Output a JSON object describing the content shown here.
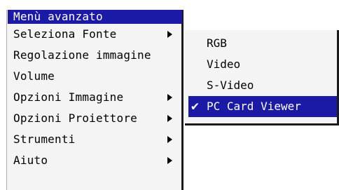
{
  "menu": {
    "title": "Menù avanzato",
    "items": [
      {
        "label": "Seleziona Fonte"
      },
      {
        "label": "Regolazione immagine"
      },
      {
        "label": "Volume"
      },
      {
        "label": "Opzioni Immagine"
      },
      {
        "label": "Opzioni Proiettore"
      },
      {
        "label": "Strumenti"
      },
      {
        "label": "Aiuto"
      }
    ]
  },
  "submenu": {
    "items": [
      {
        "label": "RGB"
      },
      {
        "label": "Video"
      },
      {
        "label": "S-Video"
      },
      {
        "label": "PC Card Viewer",
        "checked": true
      }
    ],
    "check_glyph": "✔"
  },
  "colors": {
    "highlight": "#1a1aa6",
    "menu_bg": "#f4f4f4"
  }
}
